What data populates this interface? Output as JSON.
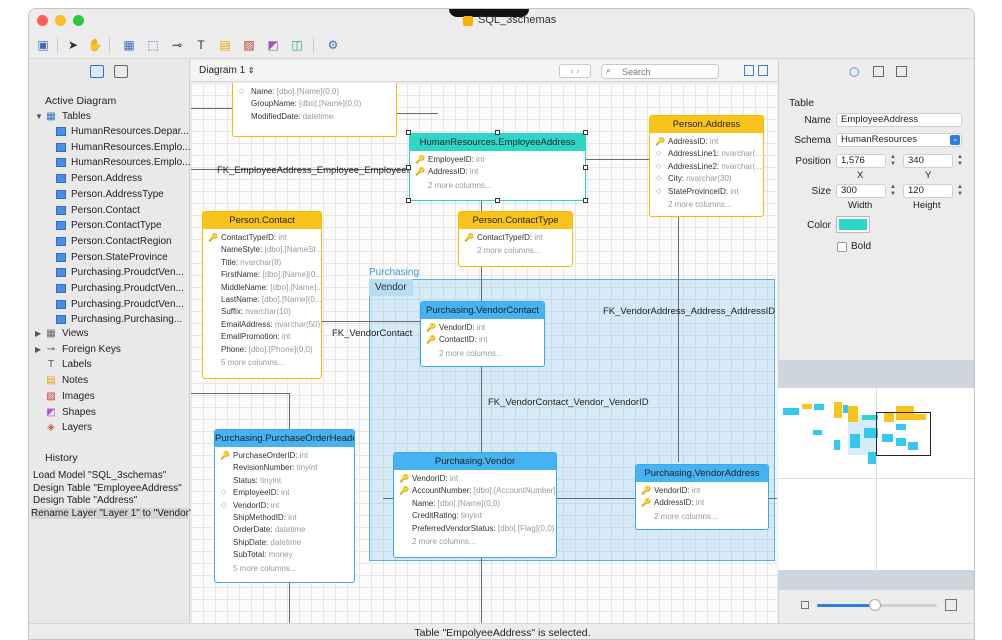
{
  "window": {
    "title": "SQL_3schemas"
  },
  "sidebar": {
    "active_diagram": "Active Diagram",
    "tables_label": "Tables",
    "tables": [
      "HumanResources.Depar...",
      "HumanResources.Emplo...",
      "HumanResources.Emplo...",
      "Person.Address",
      "Person.AddressType",
      "Person.Contact",
      "Person.ContactType",
      "Person.ContactRegion",
      "Person.StateProvince",
      "Purchasing.ProudctVen...",
      "Purchasing.ProudctVen...",
      "Purchasing.ProudctVen...",
      "Purchasing.Purchasing..."
    ],
    "groups": [
      {
        "label": "Views",
        "icon": "views-icon"
      },
      {
        "label": "Foreign Keys",
        "icon": "foreign-key-icon"
      },
      {
        "label": "Labels",
        "icon": "label-icon"
      },
      {
        "label": "Notes",
        "icon": "note-icon"
      },
      {
        "label": "Images",
        "icon": "image-icon"
      },
      {
        "label": "Shapes",
        "icon": "shape-icon"
      },
      {
        "label": "Layers",
        "icon": "layers-icon"
      }
    ],
    "history_label": "History",
    "history": [
      "Load Model \"SQL_3schemas\"",
      "Design Table \"EmployeeAddress\"",
      "Design Table \"Address\"",
      "Rename Layer \"Layer 1\" to \"Vendor\""
    ]
  },
  "canvas_bar": {
    "diagram": "Diagram 1",
    "search_placeholder": "Search"
  },
  "layer": {
    "label": "Purchasing",
    "tag": "Vendor"
  },
  "tables": {
    "top_partial": {
      "rows": [
        [
          "Name:",
          "[dbo].[Name](0,0)"
        ],
        [
          "GroupName:",
          "[dbo].[Name](0,0)"
        ],
        [
          "ModifiedDate:",
          "datetime"
        ]
      ]
    },
    "employee_address": {
      "title": "HumanResources.EmployeeAddress",
      "rows": [
        [
          "EmployeeID:",
          "int"
        ],
        [
          "AddressID:",
          "int"
        ]
      ],
      "more": "2 more columns..."
    },
    "person_address": {
      "title": "Person.Address",
      "rows": [
        [
          "AddressID:",
          "int"
        ],
        [
          "AddressLine1:",
          "nvarchar(..."
        ],
        [
          "AddressLine2:",
          "nvarchar(..."
        ],
        [
          "City:",
          "nvarchar(30)"
        ],
        [
          "StateProvinceID:",
          "int"
        ]
      ],
      "more": "2 more columns..."
    },
    "person_contact": {
      "title": "Person.Contact",
      "rows": [
        [
          "ContactTypeID:",
          "int"
        ],
        [
          "NameStyle:",
          "[dbo].[NameSt..."
        ],
        [
          "Title:",
          "nvarchar(8)"
        ],
        [
          "FirstName:",
          "[dbo].[Name](0..."
        ],
        [
          "MiddleName:",
          "[dbo].[Name]..."
        ],
        [
          "LastName:",
          "[dbo].[Name](0..."
        ],
        [
          "Suffix:",
          "nvarchar(10)"
        ],
        [
          "EmailAddress:",
          "nvarchar(50)"
        ],
        [
          "EmailPromotion:",
          "int"
        ],
        [
          "Phone:",
          "[dbo].[Phone](0,0)"
        ]
      ],
      "more": "5 more columns..."
    },
    "contact_type": {
      "title": "Person.ContactType",
      "rows": [
        [
          "ContactTypeID:",
          "int"
        ]
      ],
      "more": "2 more columns..."
    },
    "vendor_contact": {
      "title": "Purchasing.VendorContact",
      "rows": [
        [
          "VendorID:",
          "int"
        ],
        [
          "ContactID:",
          "int"
        ]
      ],
      "more": "2 more columns..."
    },
    "po_header": {
      "title": "Purchasing.PurchaseOrderHeader",
      "rows": [
        [
          "PurchaseOrderID:",
          "int"
        ],
        [
          "RevisionNumber:",
          "tinyint"
        ],
        [
          "Status:",
          "tinyint"
        ],
        [
          "EmployeeID:",
          "int"
        ],
        [
          "VendorID:",
          "int"
        ],
        [
          "ShipMethodID:",
          "int"
        ],
        [
          "OrderDate:",
          "datetime"
        ],
        [
          "ShipDate:",
          "datetime"
        ],
        [
          "SubTotal:",
          "money"
        ]
      ],
      "more": "5 more columns..."
    },
    "vendor": {
      "title": "Purchasing.Vendor",
      "rows": [
        [
          "VendorID:",
          "int"
        ],
        [
          "AccountNumber:",
          "[dbo].[AccountNumber]..."
        ],
        [
          "Name:",
          "[dbo].[Name](0,0)"
        ],
        [
          "CreditRating:",
          "tinyint"
        ],
        [
          "PreferredVendorStatus:",
          "[dbo].[Flag](0,0)"
        ]
      ],
      "more": "2 more columns..."
    },
    "vendor_address": {
      "title": "Purchasing.VendorAddress",
      "rows": [
        [
          "VendorID:",
          "int"
        ],
        [
          "AddressID:",
          "int"
        ]
      ],
      "more": "2 more columns..."
    }
  },
  "fk_labels": {
    "employee": "FK_EmployeeAddress_Employee_EmployeeID",
    "vendor_address": "FK_VendorAddress_Address_AddressID",
    "vendor_contact": "FK_VendorContact",
    "vendor_contact_vendor": "FK_VendorContact_Vendor_VendorID"
  },
  "properties": {
    "section": "Table",
    "name_label": "Name",
    "name_value": "EmployeeAddress",
    "schema_label": "Schema",
    "schema_value": "HumanResources",
    "position_label": "Position",
    "x_value": "1,576",
    "y_value": "340",
    "x_caption": "X",
    "y_caption": "Y",
    "size_label": "Size",
    "width_value": "300",
    "height_value": "120",
    "width_caption": "Width",
    "height_caption": "Height",
    "color_label": "Color",
    "color_value": "#2ed6c8",
    "bold_label": "Bold"
  },
  "minimap": {
    "zoom_level": 0.48
  },
  "status": "Table \"EmpolyeeAddress\" is selected."
}
